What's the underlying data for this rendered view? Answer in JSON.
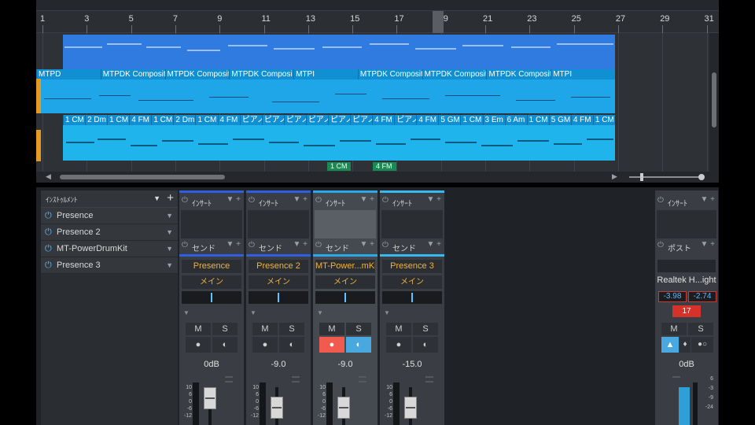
{
  "ruler": {
    "ticks": [
      "1",
      "3",
      "5",
      "7",
      "9",
      "11",
      "13",
      "15",
      "17",
      "19",
      "21",
      "23",
      "25",
      "27",
      "29",
      "31"
    ]
  },
  "lanes": {
    "lane2_segments": [
      "MTPD",
      "MTPDK CompositionCl",
      "MTPDK CompositionC",
      "MTPDK Composi",
      "MTPI",
      "MTPDK CompositionCl",
      "MTPDK CompositionCl",
      "MTPDK CompositionCl",
      "MTPI"
    ],
    "lane3_segments": [
      "1 CM",
      "2 Dm",
      "1 CM",
      "4 FM",
      "1 CM",
      "2 Dm",
      "1 CM",
      "4 FM",
      "ピアノ",
      "ピアノ",
      "ピアノ",
      "ピアノ",
      "ピアノ",
      "ピアノ",
      "4 FM",
      "ピアノ",
      "4 FM",
      "5 GM",
      "1 CM",
      "3 Em",
      "6 Am",
      "1 CM",
      "5 GM",
      "4 FM",
      "1 CM"
    ],
    "green_events": [
      "1 CM",
      "4 FM"
    ]
  },
  "instruments": {
    "header": "ｲﾝｽﾄｩﾙﾒﾝﾄ",
    "items": [
      "Presence",
      "Presence 2",
      "MT-PowerDrumKit",
      "Presence 3"
    ]
  },
  "channels": [
    {
      "insert": "ｲﾝｻｰﾄ",
      "send": "センド",
      "name": "Presence",
      "route": "メイン",
      "pan": "<C>",
      "mute": "M",
      "solo": "S",
      "volume": "0dB",
      "accent": "#2d5fe0"
    },
    {
      "insert": "ｲﾝｻｰﾄ",
      "send": "センド",
      "name": "Presence 2",
      "route": "メイン",
      "pan": "<C>",
      "mute": "M",
      "solo": "S",
      "volume": "-9.0",
      "accent": "#2d5fe0"
    },
    {
      "insert": "ｲﾝｻｰﾄ",
      "send": "センド",
      "name": "MT-Power...mKit",
      "route": "メイン",
      "pan": "<C>",
      "mute": "M",
      "solo": "S",
      "volume": "-9.0",
      "accent": "#2aa8e8"
    },
    {
      "insert": "ｲﾝｻｰﾄ",
      "send": "センド",
      "name": "Presence 3",
      "route": "メイン",
      "pan": "<C>",
      "mute": "M",
      "solo": "S",
      "volume": "-15.0",
      "accent": "#3ab8f0"
    }
  ],
  "main": {
    "insert": "ｲﾝｻｰﾄ",
    "post": "ポスト",
    "device": "Realtek H...ight",
    "peak_l": "-3.98",
    "peak_r": "-2.74",
    "channel_number": "17",
    "mute": "M",
    "solo": "S",
    "volume": "0dB"
  },
  "fader_scale": [
    "10",
    "6",
    "0",
    "-6",
    "-12"
  ],
  "main_scale": [
    "6",
    "-3",
    "-9",
    "-24"
  ]
}
